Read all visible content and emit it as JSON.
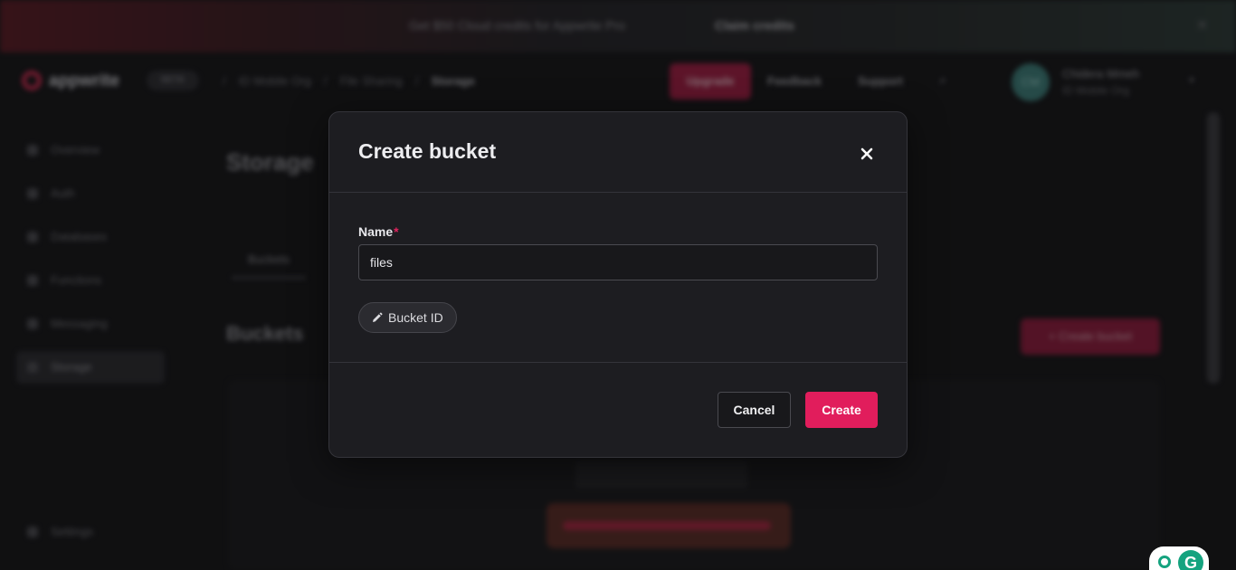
{
  "promo": {
    "text": "Get $50 Cloud credits for Appwrite Pro",
    "link": "Claim credits"
  },
  "header": {
    "logo_text": "appwrite",
    "badge": "BETA",
    "breadcrumbs": [
      "ID Mobile Org",
      "File Sharing",
      "Storage"
    ],
    "upgrade": "Upgrade",
    "feedback": "Feedback",
    "support": "Support",
    "avatar_initials": "CM",
    "user_name": "Chidera Mmeh",
    "user_org": "ID Mobile Org"
  },
  "sidebar": {
    "items": [
      {
        "label": "Overview"
      },
      {
        "label": "Auth"
      },
      {
        "label": "Databases"
      },
      {
        "label": "Functions"
      },
      {
        "label": "Messaging"
      },
      {
        "label": "Storage"
      },
      {
        "label": "Settings"
      }
    ]
  },
  "content": {
    "title": "Storage",
    "tab": "Buckets",
    "section_title": "Buckets",
    "create_button": "Create bucket"
  },
  "modal": {
    "title": "Create bucket",
    "name_label": "Name",
    "required_mark": "*",
    "name_value": "files",
    "bucket_id_label": "Bucket ID",
    "cancel": "Cancel",
    "create": "Create"
  },
  "colors": {
    "accent": "#e11d5c",
    "modal_bg": "#1d1d21"
  }
}
